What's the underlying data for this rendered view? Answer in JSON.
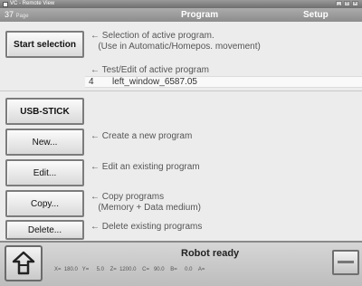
{
  "window": {
    "title": "VC - Remote View",
    "controls": [
      "minimize",
      "maximize",
      "close"
    ]
  },
  "header": {
    "page_number": "37",
    "page_label": "Page",
    "program_label": "Program",
    "setup_label": "Setup"
  },
  "sidebar": {
    "start_selection": "Start selection",
    "usb_stick": "USB-STICK",
    "new": "New...",
    "edit": "Edit...",
    "copy": "Copy...",
    "delete": "Delete..."
  },
  "descriptions": {
    "start_selection": "← Selection of active program.\n   (Use in Automatic/Homepos. movement)",
    "test_edit": "← Test/Edit of active program",
    "new": "← Create a new program",
    "edit": "← Edit an existing program",
    "copy": "← Copy programs\n   (Memory + Data medium)",
    "delete": "← Delete existing programs"
  },
  "active_program": {
    "number": "4",
    "name": "left_window_6587.05"
  },
  "status": {
    "message": "Robot ready",
    "coordinates": "X=  180.0   Y=     5.0    Z=  1200.0    C=   90.0    B=     0.0    A="
  },
  "icons": {
    "back": "back-arrow-icon",
    "app": "app-window-icon"
  },
  "colors": {
    "header_bg": "#9c9c9c",
    "button_border": "#7c7c7c"
  }
}
